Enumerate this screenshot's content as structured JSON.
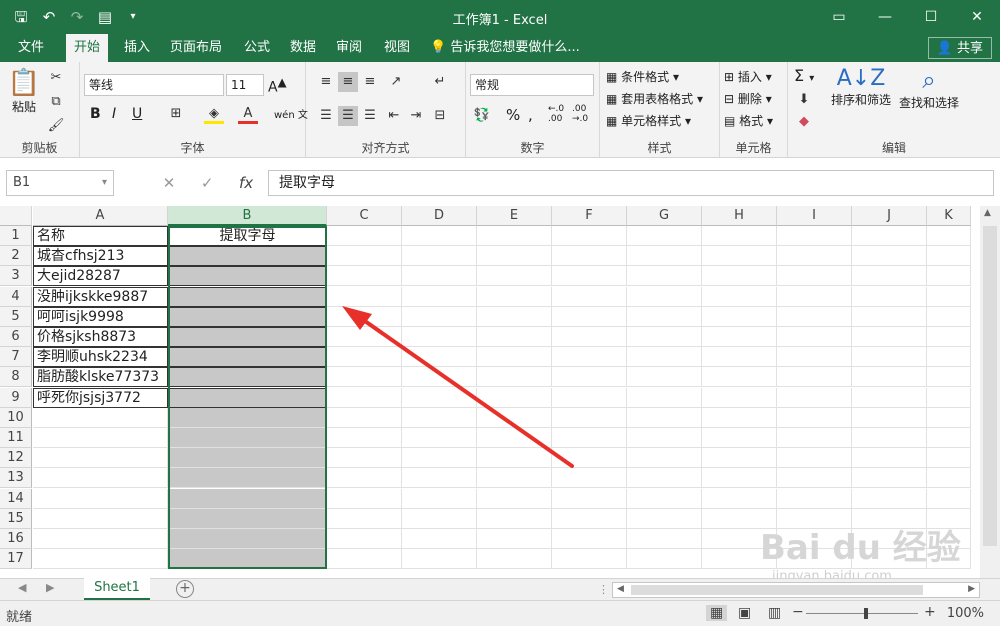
{
  "window": {
    "title": "工作簿1 - Excel",
    "qat": [
      "save-icon",
      "undo-icon",
      "redo-icon",
      "form-icon",
      "customize-icon"
    ]
  },
  "ribbon_tabs": [
    "文件",
    "开始",
    "插入",
    "页面布局",
    "公式",
    "数据",
    "审阅",
    "视图"
  ],
  "active_tab": "开始",
  "tell_me": "告诉我您想要做什么...",
  "share": "共享",
  "clipboard": {
    "paste": "粘贴",
    "label": "剪贴板"
  },
  "font": {
    "name": "等线",
    "size": "11",
    "label": "字体",
    "bold": "B",
    "italic": "I",
    "underline": "U",
    "wen": "wén 文"
  },
  "alignment": {
    "label": "对齐方式"
  },
  "number": {
    "format": "常规",
    "label": "数字",
    "percent": "%",
    "comma": ","
  },
  "styles": {
    "conditional": "条件格式",
    "table": "套用表格格式",
    "cell": "单元格样式",
    "label": "样式"
  },
  "cells": {
    "insert": "插入",
    "delete": "删除",
    "format": "格式",
    "label": "单元格"
  },
  "editing": {
    "sortfilter": "排序和筛选",
    "findselect": "查找和选择",
    "label": "编辑",
    "sigma": "Σ"
  },
  "formula_bar": {
    "name_box": "B1",
    "fx": "fx",
    "content": "提取字母"
  },
  "columns": [
    "A",
    "B",
    "C",
    "D",
    "E",
    "F",
    "G",
    "H",
    "I",
    "J",
    "K"
  ],
  "rows": [
    "1",
    "2",
    "3",
    "4",
    "5",
    "6",
    "7",
    "8",
    "9",
    "10",
    "11",
    "12",
    "13",
    "14",
    "15",
    "16",
    "17"
  ],
  "cells_A": [
    "名称",
    "城杳cfhsj213",
    "大ejid28287",
    "没肿ijkskke9887",
    "呵呵isjk9998",
    "价格sjksh8873",
    "李明顺uhsk2234",
    "脂肪酸klske77373",
    "呼死你jsjsj3772"
  ],
  "cell_B1": "提取字母",
  "sheet_tabs": [
    "Sheet1"
  ],
  "status": {
    "ready": "就绪",
    "zoom": "100%"
  },
  "watermark": {
    "brand": "Bai du 经验",
    "url": "jingyan.baidu.com"
  },
  "colors": {
    "accent": "#217346",
    "arrow": "#e8302a",
    "selected_fill": "#c8c8c8"
  }
}
